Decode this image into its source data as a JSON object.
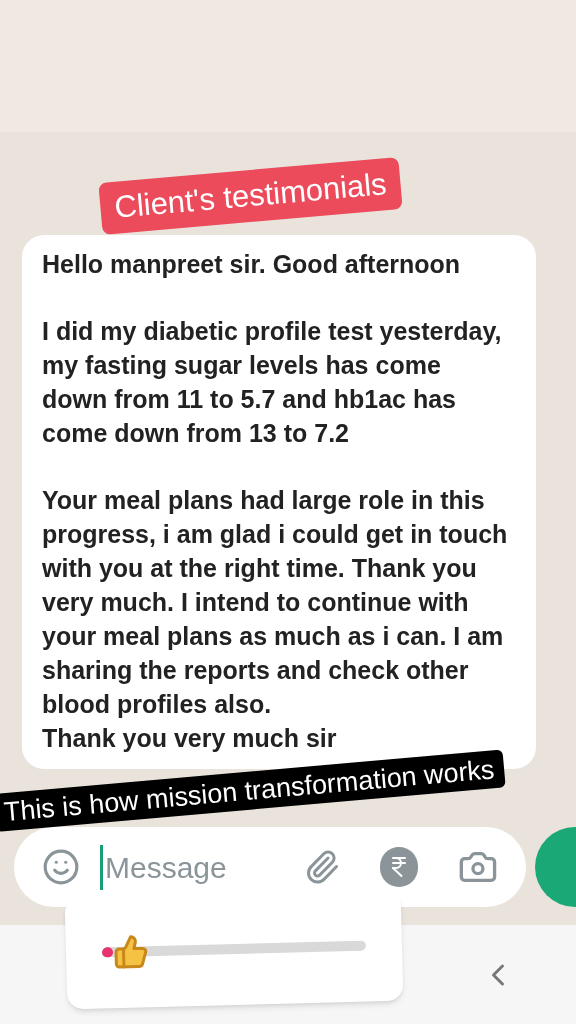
{
  "sticker_title": "Client's testimonials",
  "message": {
    "blocks": [
      [
        "Hello manpreet sir. Good afternoon"
      ],
      [
        "I did my diabetic profile test yesterday, my fasting sugar levels has come down from 11 to 5.7 and hb1ac has come down from 13 to 7.2"
      ],
      [
        "Your meal plans had large role in this progress, i am glad i could get in touch with you at the right time. Thank you very much. I intend to continue with your meal plans as much as i can. I am sharing the reports and check other blood profiles also.",
        "Thank you very much sir"
      ]
    ]
  },
  "caption": "This is how mission transformation works",
  "composer": {
    "placeholder": "Message"
  },
  "emoji_slider": {
    "level": 0.04
  }
}
